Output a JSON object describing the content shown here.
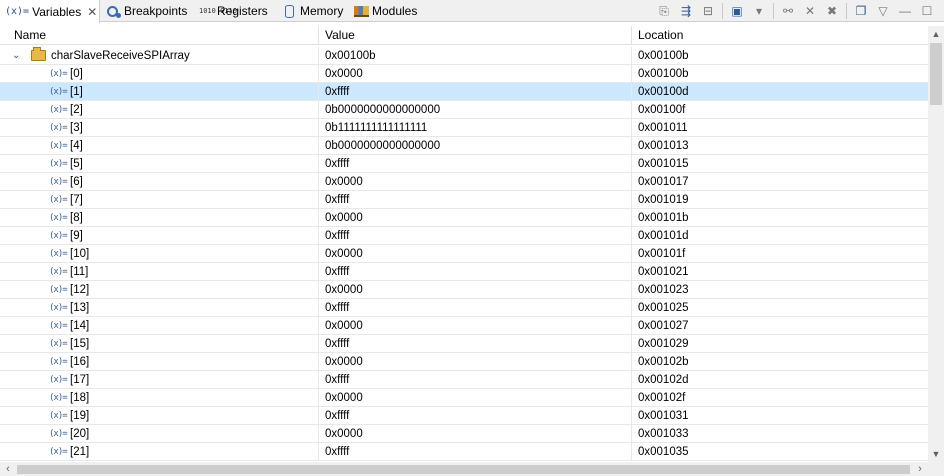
{
  "tabs": [
    {
      "icon": "variables-icon",
      "icon_glyph": "(x)=",
      "label": "Variables",
      "active": true
    },
    {
      "icon": "breakpoints-icon",
      "label": "Breakpoints",
      "active": false
    },
    {
      "icon": "registers-icon",
      "icon_glyph": "1010 0110",
      "label": "Registers",
      "active": false
    },
    {
      "icon": "memory-icon",
      "label": "Memory",
      "active": false
    },
    {
      "icon": "modules-icon",
      "label": "Modules",
      "active": false
    }
  ],
  "tab_close_glyph": "✕",
  "columns": {
    "name": "Name",
    "value": "Value",
    "location": "Location"
  },
  "root": {
    "name": "charSlaveReceiveSPIArray",
    "value": "0x00100b",
    "location": "0x00100b",
    "expanded": true
  },
  "var_icon_glyph": "(x)=",
  "rows": [
    {
      "name": "[0]",
      "value": "0x0000",
      "location": "0x00100b"
    },
    {
      "name": "[1]",
      "value": "0xffff",
      "location": "0x00100d",
      "selected": true
    },
    {
      "name": "[2]",
      "value": "0b0000000000000000",
      "location": "0x00100f"
    },
    {
      "name": "[3]",
      "value": "0b1111111111111111",
      "location": "0x001011"
    },
    {
      "name": "[4]",
      "value": "0b0000000000000000",
      "location": "0x001013"
    },
    {
      "name": "[5]",
      "value": "0xffff",
      "location": "0x001015"
    },
    {
      "name": "[6]",
      "value": "0x0000",
      "location": "0x001017"
    },
    {
      "name": "[7]",
      "value": "0xffff",
      "location": "0x001019"
    },
    {
      "name": "[8]",
      "value": "0x0000",
      "location": "0x00101b"
    },
    {
      "name": "[9]",
      "value": "0xffff",
      "location": "0x00101d"
    },
    {
      "name": "[10]",
      "value": "0x0000",
      "location": "0x00101f"
    },
    {
      "name": "[11]",
      "value": "0xffff",
      "location": "0x001021"
    },
    {
      "name": "[12]",
      "value": "0x0000",
      "location": "0x001023"
    },
    {
      "name": "[13]",
      "value": "0xffff",
      "location": "0x001025"
    },
    {
      "name": "[14]",
      "value": "0x0000",
      "location": "0x001027"
    },
    {
      "name": "[15]",
      "value": "0xffff",
      "location": "0x001029"
    },
    {
      "name": "[16]",
      "value": "0x0000",
      "location": "0x00102b"
    },
    {
      "name": "[17]",
      "value": "0xffff",
      "location": "0x00102d"
    },
    {
      "name": "[18]",
      "value": "0x0000",
      "location": "0x00102f"
    },
    {
      "name": "[19]",
      "value": "0xffff",
      "location": "0x001031"
    },
    {
      "name": "[20]",
      "value": "0x0000",
      "location": "0x001033"
    },
    {
      "name": "[21]",
      "value": "0xffff",
      "location": "0x001035"
    }
  ],
  "colors": {
    "selection": "#cce8ff",
    "tab_bar": "#f0f0f0",
    "grid": "#e8e8e8"
  }
}
